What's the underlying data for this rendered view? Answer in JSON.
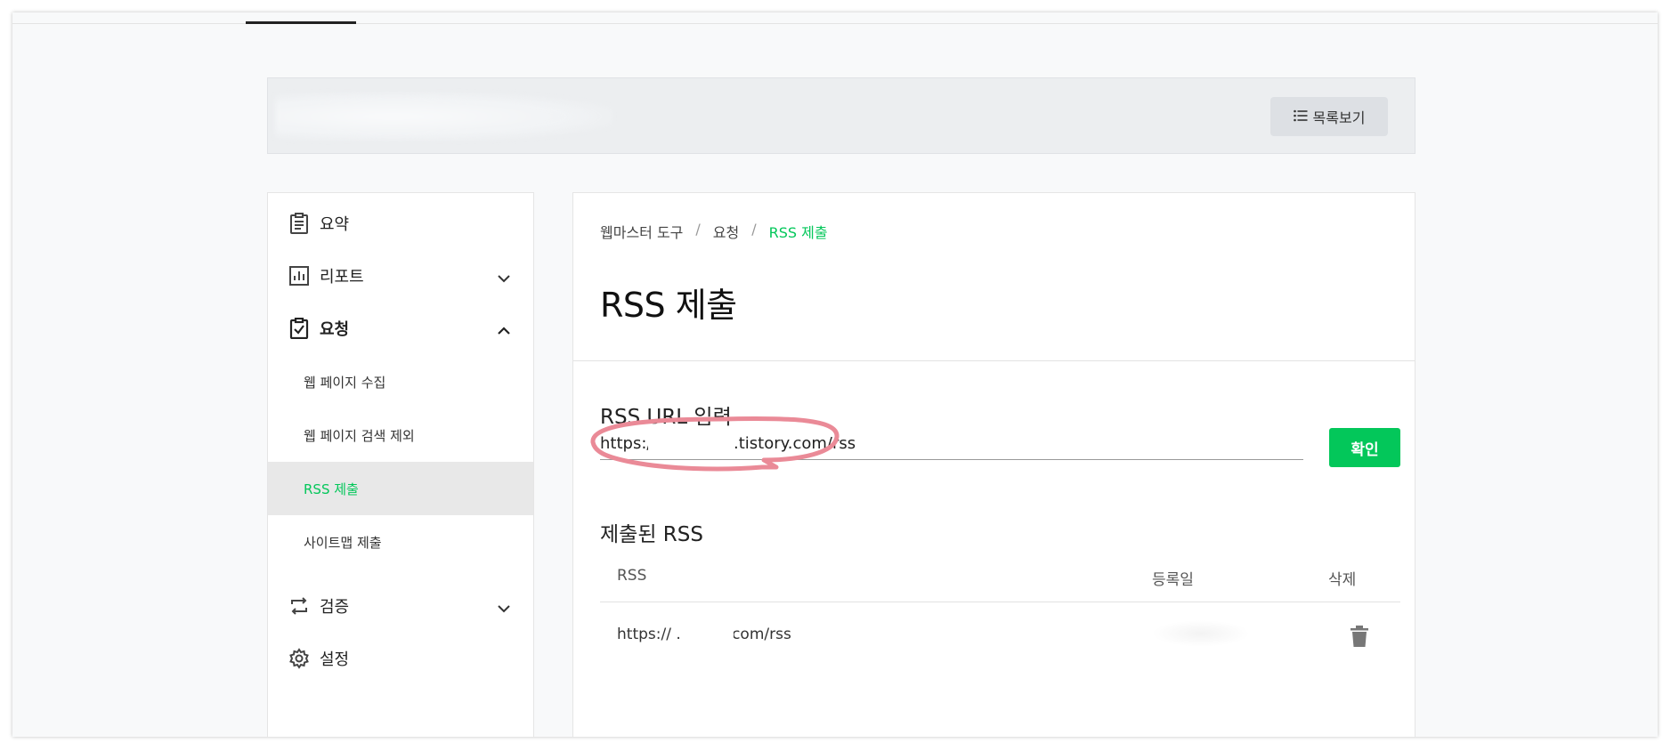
{
  "header": {
    "list_button_label": "목록보기"
  },
  "sidebar": {
    "items": [
      {
        "label": "요약",
        "icon": "clipboard-icon"
      },
      {
        "label": "리포트",
        "icon": "chart-icon",
        "expanded": false
      },
      {
        "label": "요청",
        "icon": "clipboard-check-icon",
        "expanded": true
      },
      {
        "label": "검증",
        "icon": "repeat-icon",
        "expanded": false
      },
      {
        "label": "설정",
        "icon": "gear-icon"
      }
    ],
    "sub_items": [
      {
        "label": "웹 페이지 수집"
      },
      {
        "label": "웹 페이지 검색 제외"
      },
      {
        "label": "RSS 제출",
        "active": true
      },
      {
        "label": "사이트맵 제출"
      }
    ]
  },
  "breadcrumb": [
    "웹마스터 도구",
    "요청",
    "RSS 제출"
  ],
  "page_title": "RSS 제출",
  "rss_input": {
    "label": "RSS URL 입력",
    "value": "https:/                .tistory.com/rss",
    "confirm_label": "확인"
  },
  "submitted": {
    "label": "제출된 RSS",
    "columns": [
      "RSS",
      "등록일",
      "삭제"
    ],
    "rows": [
      {
        "rss": "https://               .tistory.com/rss",
        "date": ""
      }
    ]
  },
  "colors": {
    "accent": "#03c75a",
    "highlight_ring": "#ea8a97"
  }
}
